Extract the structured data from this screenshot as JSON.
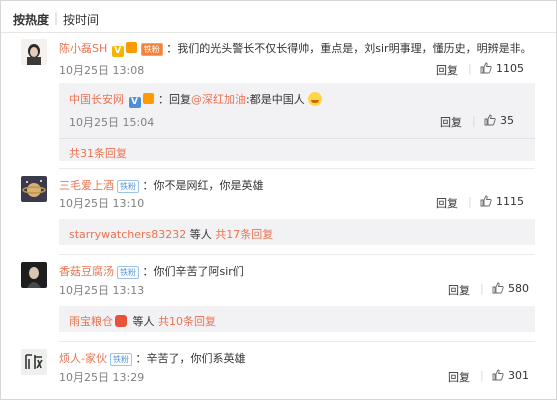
{
  "sort": {
    "hot": "按热度",
    "time": "按时间"
  },
  "comments": [
    {
      "user": "陈小磊SH",
      "fan_tag": "铁粉",
      "text": "：我们的光头警长不仅长得帅，重点是，刘sir明事理，懂历史，明辨是非。",
      "time": "10月25日 13:08",
      "reply_label": "回复",
      "likes": "1105",
      "reply": {
        "user": "中国长安网",
        "text_prefix": "：回复",
        "mention": "@深红加油",
        "text": ":都是中国人",
        "time": "10月25日 15:04",
        "reply_label": "回复",
        "likes": "35"
      },
      "more": "共31条回复"
    },
    {
      "user": "三毛爱上酒",
      "fan_tag": "铁粉",
      "text": "：你不是网红，你是英雄",
      "time": "10月25日 13:10",
      "reply_label": "回复",
      "likes": "1115",
      "summary": {
        "user": "starrywatchers83232",
        "mid": " 等人 ",
        "more": "共17条回复"
      }
    },
    {
      "user": "香菇豆腐汤",
      "fan_tag": "铁粉",
      "text": "：你们辛苦了阿sir们",
      "time": "10月25日 13:13",
      "reply_label": "回复",
      "likes": "580",
      "summary": {
        "user": "雨宝粮仓",
        "mid": " 等人 ",
        "more": "共10条回复"
      }
    },
    {
      "user": "烦人-家伙",
      "fan_tag": "铁粉",
      "text": "：辛苦了，你们系英雄",
      "time": "10月25日 13:29",
      "reply_label": "回复",
      "likes": "301"
    }
  ],
  "colors": {
    "link": "#eb7350",
    "reply_bg": "#f2f2f5"
  }
}
